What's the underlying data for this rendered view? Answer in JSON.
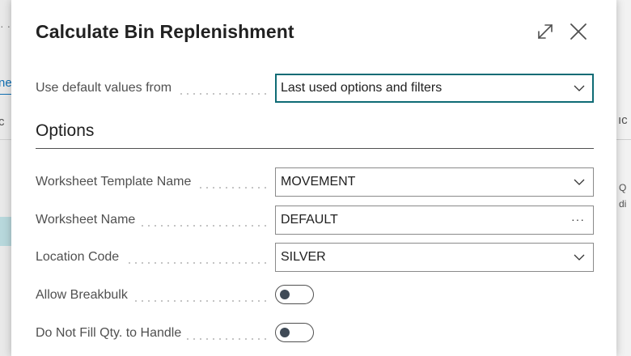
{
  "background": {
    "left_link_text": "ne",
    "left_text": "c",
    "left_dots": "· ·",
    "right_text": "ıc",
    "right_text2": "Q",
    "right_text3": "di"
  },
  "dialog": {
    "title": "Calculate Bin Replenishment",
    "default_values": {
      "label": "Use default values from",
      "value": "Last used options and filters"
    },
    "options_section": {
      "title": "Options",
      "fields": [
        {
          "label": "Worksheet Template Name",
          "value": "MOVEMENT",
          "control": "dropdown"
        },
        {
          "label": "Worksheet Name",
          "value": "DEFAULT",
          "control": "lookup"
        },
        {
          "label": "Location Code",
          "value": "SILVER",
          "control": "dropdown"
        },
        {
          "label": "Allow Breakbulk",
          "value": "off",
          "control": "toggle"
        },
        {
          "label": "Do Not Fill Qty. to Handle",
          "value": "off",
          "control": "toggle"
        }
      ]
    },
    "lookup_glyph": "···"
  },
  "icons": {
    "expand": "expand-icon",
    "close": "close-icon",
    "chevron": "chevron-down-icon"
  }
}
